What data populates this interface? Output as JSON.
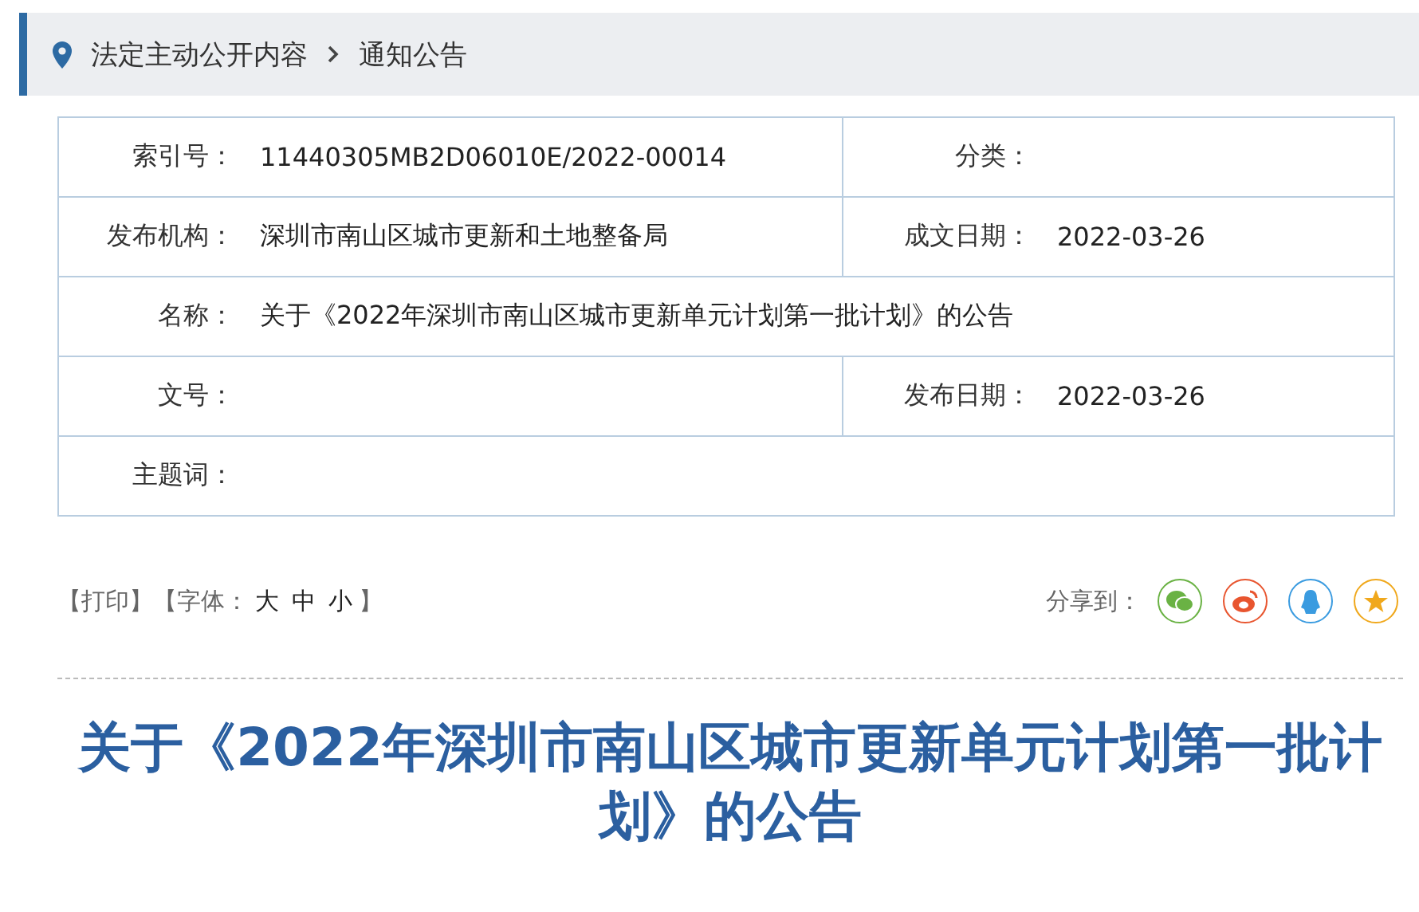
{
  "breadcrumb": {
    "items": [
      "法定主动公开内容",
      "通知公告"
    ]
  },
  "info_table": {
    "rows": [
      {
        "cells": [
          {
            "label": "索引号：",
            "value": "11440305MB2D06010E/2022-00014"
          },
          {
            "label": "分类："
          }
        ]
      },
      {
        "cells": [
          {
            "label": "发布机构：",
            "value": "深圳市南山区城市更新和土地整备局"
          },
          {
            "label": "成文日期：",
            "value": "2022-03-26"
          }
        ]
      },
      {
        "cells": [
          {
            "label": "名称：",
            "value": "关于《2022年深圳市南山区城市更新单元计划第一批计划》的公告"
          }
        ]
      },
      {
        "cells": [
          {
            "label": "文号："
          },
          {
            "label": "发布日期：",
            "value": "2022-03-26"
          }
        ]
      },
      {
        "cells": [
          {
            "label": "主题词："
          }
        ]
      }
    ]
  },
  "toolbar": {
    "print": "【打印】",
    "font_open": "【字体：",
    "font_sizes": [
      "大",
      "中",
      "小"
    ],
    "font_close": "】",
    "share_label": "分享到：",
    "share_buttons": [
      {
        "kind": "wechat",
        "color": "#6ab244"
      },
      {
        "kind": "weibo",
        "color": "#e8552f"
      },
      {
        "kind": "qq",
        "color": "#3a9be0"
      },
      {
        "kind": "favorite",
        "color": "#f0a81c"
      }
    ]
  },
  "title": "关于《2022年深圳市南山区城市更新单元计划第一批计划》的公告"
}
